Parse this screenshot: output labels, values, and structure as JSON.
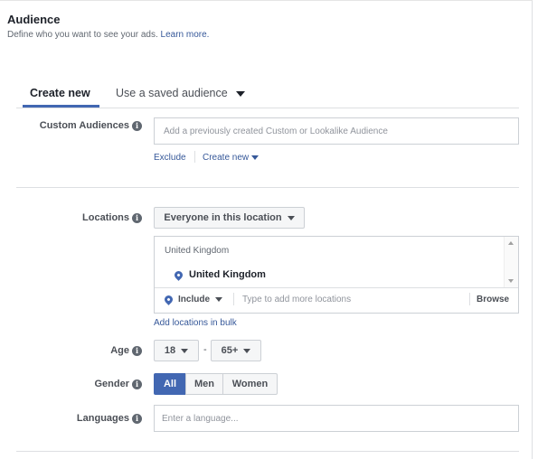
{
  "header": {
    "title": "Audience",
    "subtitle": "Define who you want to see your ads.",
    "learn_more": "Learn more."
  },
  "tabs": [
    {
      "label": "Create new",
      "active": true
    },
    {
      "label": "Use a saved audience",
      "active": false
    }
  ],
  "custom_audiences": {
    "label": "Custom Audiences",
    "placeholder": "Add a previously created Custom or Lookalike Audience",
    "exclude": "Exclude",
    "create_new": "Create new"
  },
  "locations": {
    "label": "Locations",
    "dropdown": "Everyone in this location",
    "group_header": "United Kingdom",
    "selected": "United Kingdom",
    "include": "Include",
    "placeholder": "Type to add more locations",
    "browse": "Browse",
    "bulk_link": "Add locations in bulk"
  },
  "age": {
    "label": "Age",
    "min": "18",
    "separator": "-",
    "max": "65+"
  },
  "gender": {
    "label": "Gender",
    "options": [
      "All",
      "Men",
      "Women"
    ],
    "selected": "All"
  },
  "languages": {
    "label": "Languages",
    "placeholder": "Enter a language..."
  },
  "colors": {
    "accent": "#4267b2",
    "link": "#365899",
    "border": "#ccd0d5"
  }
}
